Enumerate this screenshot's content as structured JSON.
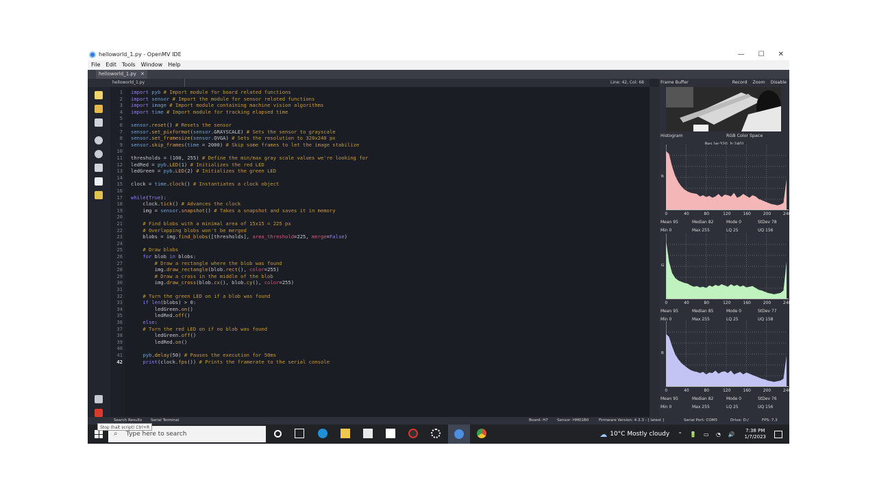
{
  "window": {
    "title": "helloworld_1.py - OpenMV IDE",
    "controls": [
      "—",
      "☐",
      "✕"
    ]
  },
  "menu": [
    "File",
    "Edit",
    "Tools",
    "Window",
    "Help"
  ],
  "tab": {
    "label": "helloworld_1.py",
    "close": "✕"
  },
  "editor_toolbar": {
    "file_label": "helloworld_1.py",
    "cursor_position": "Line: 42, Col: 68"
  },
  "code_lines": [
    "import pyb # Import module for board related functions",
    "import sensor # Import the module for sensor related functions",
    "import image # Import module containing machine vision algorithms",
    "import time # Import module for tracking elapsed time",
    "",
    "sensor.reset() # Resets the sensor",
    "sensor.set_pixformat(sensor.GRAYSCALE) # Sets the sensor to grayscale",
    "sensor.set_framesize(sensor.QVGA) # Sets the resolution to 320x240 px",
    "sensor.skip_frames(time = 2000) # Skip some frames to let the image stabilize",
    "",
    "thresholds = (100, 255) # Define the min/max gray scale values we're looking for",
    "ledRed = pyb.LED(1) # Initializes the red LED",
    "ledGreen = pyb.LED(2) # Initializes the green LED",
    "",
    "clock = time.clock() # Instantiates a clock object",
    "",
    "while(True):",
    "    clock.tick() # Advances the clock",
    "    img = sensor.snapshot() # Takes a snapshot and saves it in memory",
    "",
    "    # Find blobs with a minimal area of 15x15 = 225 px",
    "    # Overlapping blobs won't be merged",
    "    blobs = img.find_blobs([thresholds], area_threshold=225, merge=False)",
    "",
    "    # Draw blobs",
    "    for blob in blobs:",
    "        # Draw a rectangle where the blob was found",
    "        img.draw_rectangle(blob.rect(), color=255)",
    "        # Draw a cross in the middle of the blob",
    "        img.draw_cross(blob.cx(), blob.cy(), color=255)",
    "",
    "    # Turn the green LED on if a blob was found",
    "    if len(blobs) > 0:",
    "        ledGreen.on()",
    "        ledRed.off()",
    "    else:",
    "    # Turn the red LED on if no blob was found",
    "        ledGreen.off()",
    "        ledRed.on()",
    "",
    "    pyb.delay(50) # Pauses the execution for 50ms",
    "    print(clock.fps()) # Prints the framerate to the serial console"
  ],
  "frame_buffer": {
    "title": "Frame Buffer",
    "record": "Record",
    "zoom": "Zoom",
    "disable": "Disable"
  },
  "histogram": {
    "title": "Histogram",
    "color_space": "RGB Color Space",
    "resolution": "Res (w:320, h:240)",
    "x_ticks": [
      "0",
      "40",
      "80",
      "120",
      "160",
      "200",
      "240"
    ],
    "channels": [
      {
        "label": "R",
        "color": "#f4b6b6",
        "mean": "95",
        "median": "82",
        "mode": "0",
        "stdev": "78",
        "min": "0",
        "max": "255",
        "lq": "25",
        "uq": "156",
        "profile": [
          0.95,
          0.9,
          0.7,
          0.55,
          0.45,
          0.38,
          0.33,
          0.3,
          0.28,
          0.27,
          0.26,
          0.22,
          0.24,
          0.21,
          0.23,
          0.2,
          0.22,
          0.26,
          0.21,
          0.25,
          0.24,
          0.22,
          0.28,
          0.2,
          0.22,
          0.26,
          0.23,
          0.2,
          0.24,
          0.22,
          0.18,
          0.16,
          0.14,
          0.12,
          0.1,
          0.09,
          0.08,
          0.09,
          0.12,
          0.5
        ]
      },
      {
        "label": "G",
        "color": "#bff2bf",
        "mean": "95",
        "median": "85",
        "mode": "0",
        "stdev": "77",
        "min": "0",
        "max": "255",
        "lq": "25",
        "uq": "158",
        "profile": [
          0.95,
          0.6,
          0.42,
          0.34,
          0.3,
          0.28,
          0.26,
          0.25,
          0.22,
          0.2,
          0.21,
          0.19,
          0.2,
          0.18,
          0.22,
          0.2,
          0.23,
          0.21,
          0.24,
          0.22,
          0.2,
          0.24,
          0.21,
          0.23,
          0.2,
          0.22,
          0.19,
          0.2,
          0.21,
          0.18,
          0.15,
          0.14,
          0.12,
          0.1,
          0.09,
          0.08,
          0.09,
          0.1,
          0.14,
          0.6
        ]
      },
      {
        "label": "B",
        "color": "#c3c3f4",
        "mean": "95",
        "median": "82",
        "mode": "0",
        "stdev": "76",
        "min": "0",
        "max": "255",
        "lq": "25",
        "uq": "156",
        "profile": [
          0.85,
          0.8,
          0.65,
          0.52,
          0.44,
          0.38,
          0.34,
          0.3,
          0.27,
          0.25,
          0.24,
          0.22,
          0.24,
          0.2,
          0.23,
          0.22,
          0.26,
          0.21,
          0.24,
          0.25,
          0.22,
          0.26,
          0.2,
          0.22,
          0.24,
          0.2,
          0.23,
          0.21,
          0.19,
          0.17,
          0.15,
          0.13,
          0.12,
          0.1,
          0.09,
          0.08,
          0.09,
          0.1,
          0.13,
          0.5
        ]
      }
    ],
    "stat_labels": {
      "mean": "Mean",
      "median": "Median",
      "mode": "Mode",
      "stdev": "StDev",
      "min": "Min",
      "max": "Max",
      "lq": "LQ",
      "uq": "UQ"
    }
  },
  "status": {
    "search_results": "Search Results",
    "serial_terminal": "Serial Terminal",
    "board": "Board: H7",
    "sensor": "Sensor: HM01B0",
    "firmware": "Firmware Version: 4.3.3 - [ latest ]",
    "serial_port": "Serial Port: COM5",
    "drive": "Drive: D:/",
    "fps": "FPS: 7.3"
  },
  "tooltip": "Stop (halt script) Ctrl+R",
  "taskbar": {
    "search_placeholder": "Type here to search",
    "weather": "10°C  Mostly cloudy",
    "time": "7:38 PM",
    "date": "1/7/2023"
  }
}
